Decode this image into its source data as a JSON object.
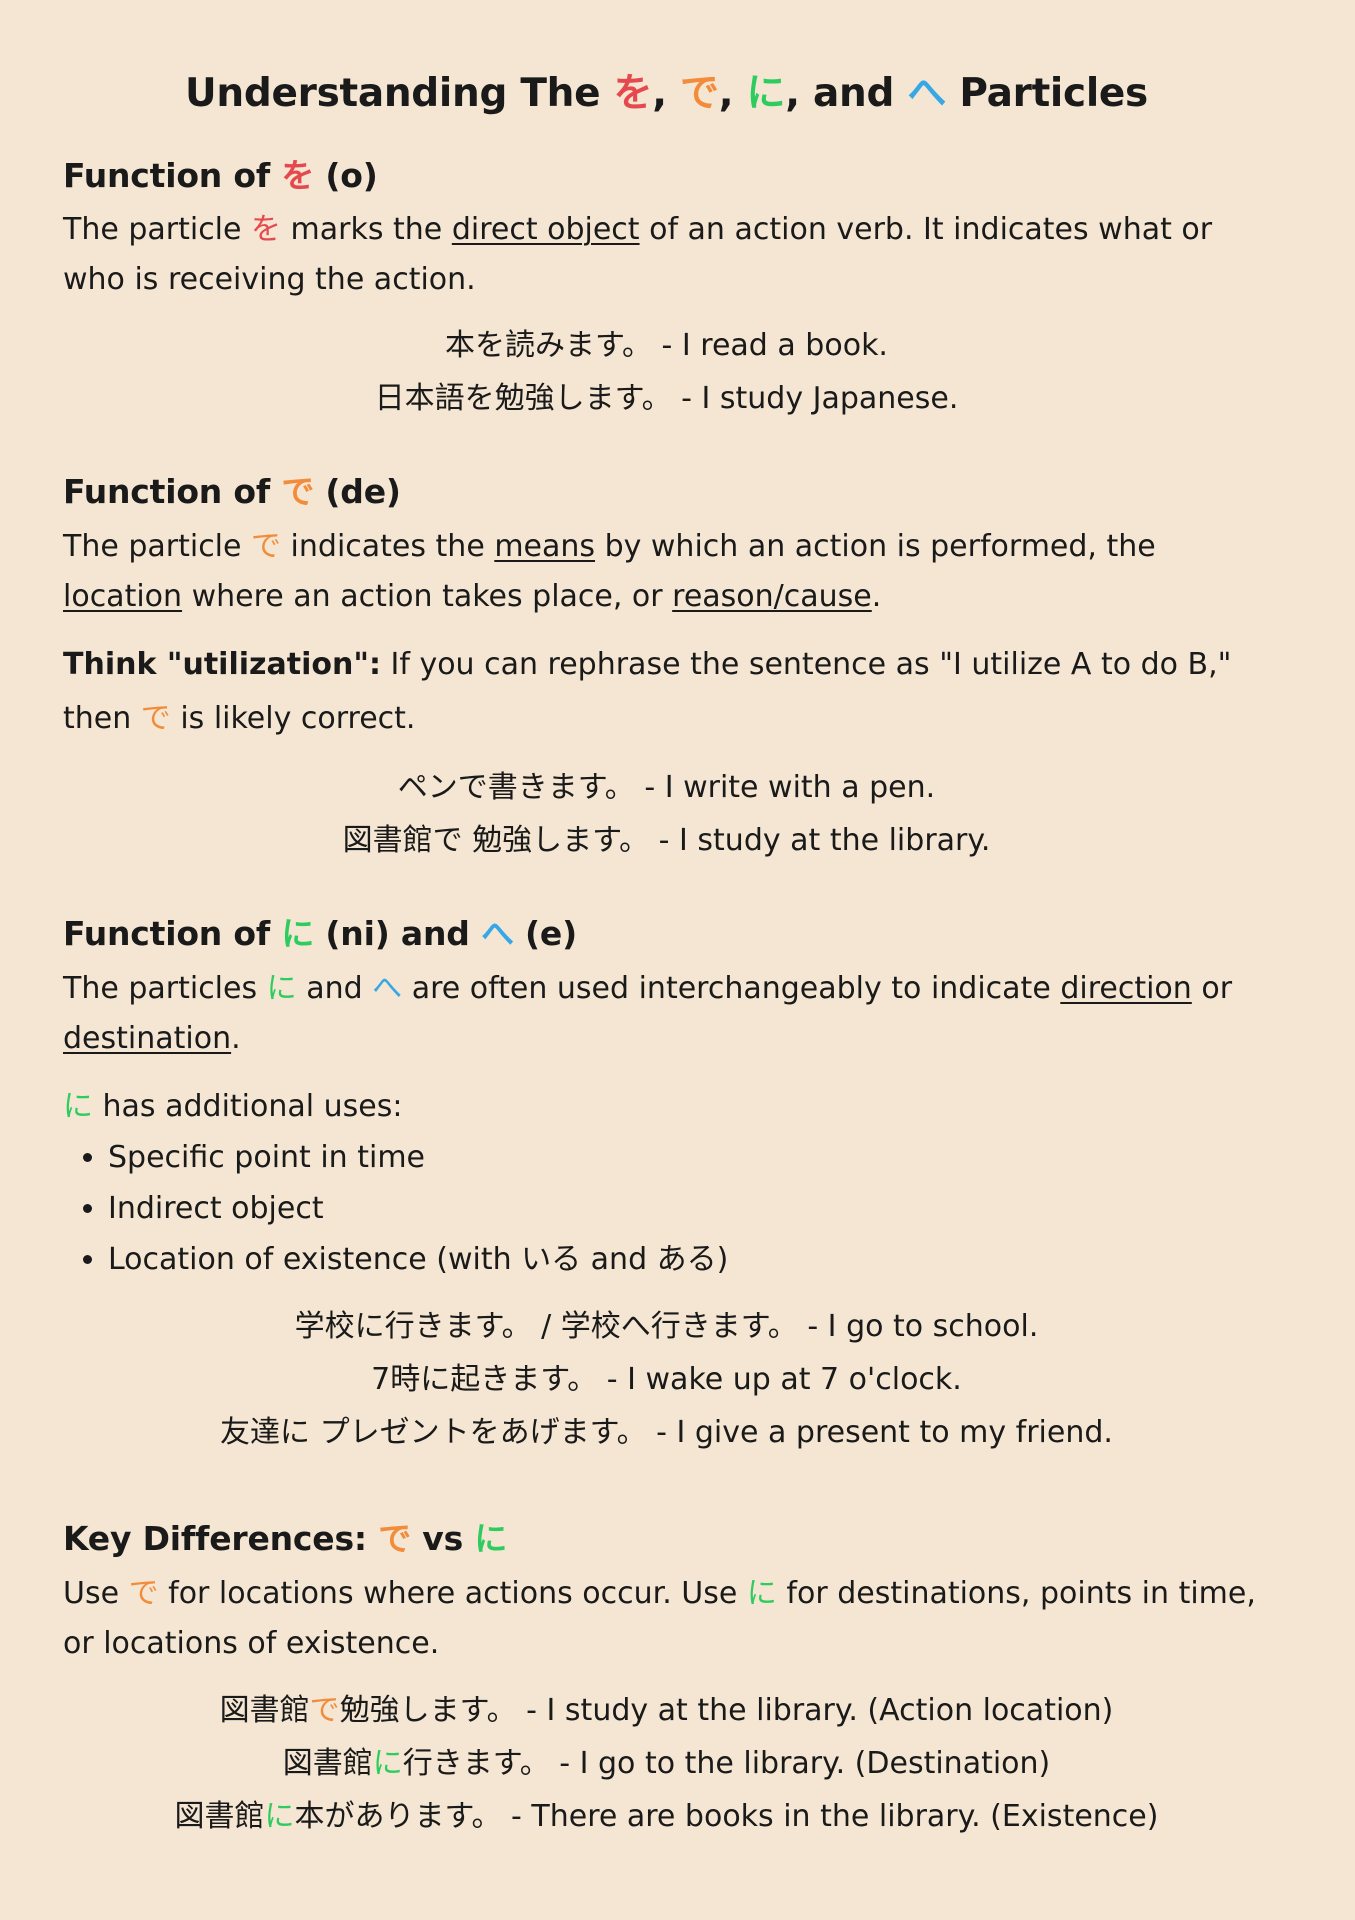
{
  "title": {
    "prefix": "Understanding The ",
    "p1": "を",
    "sep1": ", ",
    "p2": "で",
    "sep2": ", ",
    "p3": "に",
    "sep3": ", and ",
    "p4": "へ",
    "suffix": " Particles"
  },
  "colors": {
    "wo": "#e5484d",
    "de": "#f28c3a",
    "ni": "#2ecc5e",
    "he": "#37a7e6",
    "background": "#f4e6d2"
  },
  "section_o": {
    "heading_prefix": "Function of ",
    "heading_particle": "を",
    "heading_suffix": " (o)",
    "text_1": "The particle ",
    "text_particle": "を",
    "text_2": " marks the ",
    "text_underline": "direct object",
    "text_3": " of an action verb. It indicates what or who is receiving the action.",
    "examples": [
      "本を読みます。 - I read a book.",
      "日本語を勉強します。 - I study Japanese."
    ]
  },
  "section_de": {
    "heading_prefix": "Function of ",
    "heading_particle": "で",
    "heading_suffix": " (de)",
    "text_1": "The particle ",
    "text_particle": "で",
    "text_2": " indicates the ",
    "text_u1": "means",
    "text_3": " by which an action is performed, the ",
    "text_u2": "location",
    "text_4": " where an action takes place, or ",
    "text_u3": "reason/cause",
    "text_5": ".",
    "think_bold": "Think \"utilization\":",
    "think_1": " If you can rephrase the sentence as \"I utilize A to do B,\" then ",
    "think_particle": "で",
    "think_2": " is likely correct.",
    "examples": [
      "ペンで書きます。 - I write with a pen.",
      "図書館で 勉強します。 - I study at the library."
    ]
  },
  "section_ni": {
    "heading_prefix": "Function of ",
    "heading_particle1": "に",
    "heading_mid": " (ni) and ",
    "heading_particle2": "へ",
    "heading_suffix": " (e)",
    "text_1": "The particles ",
    "text_particle1": "に",
    "text_2": " and ",
    "text_particle2": "へ",
    "text_3": " are often used interchangeably to indicate ",
    "text_u1": "direction",
    "text_4": " or ",
    "text_u2": "destination",
    "text_5": ".",
    "additional_particle": "に",
    "additional_text": " has additional uses:",
    "uses": [
      "Specific point in time",
      "Indirect object",
      "Location of existence (with いる and ある)"
    ],
    "examples": [
      "学校に行きます。 / 学校へ行きます。 - I go to school.",
      "7時に起きます。 - I wake up at 7 o'clock.",
      "友達に プレゼントをあげます。 - I give a present to my friend."
    ]
  },
  "section_diff": {
    "heading_prefix": "Key Differences: ",
    "heading_particle1": "で",
    "heading_mid": " vs ",
    "heading_particle2": "に",
    "text_1": "Use ",
    "text_particle1": "で",
    "text_2": " for locations where actions occur. Use ",
    "text_particle2": "に",
    "text_3": " for destinations, points in time, or locations of existence.",
    "examples": [
      {
        "pre": "図書館",
        "particle": "で",
        "post": "勉強します。 - I study at the library. (Action location)"
      },
      {
        "pre": "図書館",
        "particle": "に",
        "post": "行きます。 - I go to the library. (Destination)"
      },
      {
        "pre": "図書館",
        "particle": "に",
        "post": "本があります。 - There are books in the library. (Existence)"
      }
    ]
  }
}
